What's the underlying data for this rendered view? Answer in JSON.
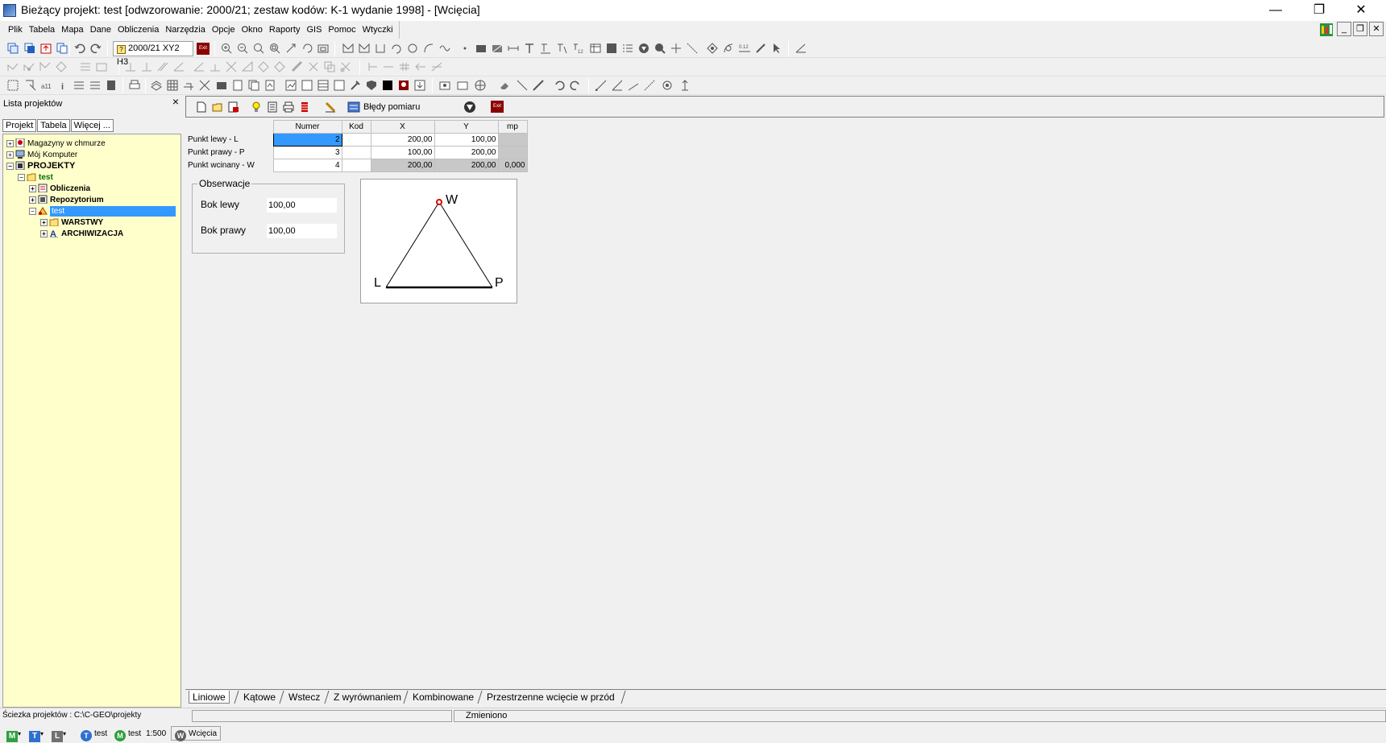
{
  "window": {
    "title": "Bieżący projekt: test [odwzorowanie: 2000/21; zestaw kodów: K-1 wydanie 1998] - [Wcięcia]",
    "minimize": "—",
    "maximize": "❐",
    "close": "✕"
  },
  "menu": [
    "Plik",
    "Tabela",
    "Mapa",
    "Dane",
    "Obliczenia",
    "Narzędzia",
    "Opcje",
    "Okno",
    "Raporty",
    "GIS",
    "Pomoc",
    "Wtyczki"
  ],
  "mdi_buttons": {
    "min": "_",
    "restore": "❐",
    "close": "✕"
  },
  "toolbar": {
    "projection_combo": "2000/21 XY2 H3",
    "exit_label": "Exit"
  },
  "left_panel": {
    "title": "Lista projektów",
    "close": "×",
    "tabs": [
      "Projekt",
      "Tabela",
      "Więcej ..."
    ],
    "tree": {
      "magazyny": "Magazyny w chmurze",
      "komputer": "Mój Komputer",
      "projekty": "PROJEKTY",
      "test_folder": "test",
      "obliczenia": "Obliczenia",
      "repozytorium": "Repozytorium",
      "test_item": "test",
      "warstwy": "WARSTWY",
      "archiwizacja": "ARCHIWIZACJA"
    }
  },
  "main_toolbar": {
    "bledy_label": "Błędy pomiaru",
    "exit_label": "Exit"
  },
  "grid": {
    "headers": [
      "Numer",
      "Kod",
      "X",
      "Y",
      "mp"
    ],
    "rows": [
      {
        "label": "Punkt lewy - L",
        "numer": "2",
        "kod": "",
        "x": "200,00",
        "y": "100,00",
        "mp": ""
      },
      {
        "label": "Punkt prawy - P",
        "numer": "3",
        "kod": "",
        "x": "100,00",
        "y": "200,00",
        "mp": ""
      },
      {
        "label": "Punkt wcinany - W",
        "numer": "4",
        "kod": "",
        "x": "200,00",
        "y": "200,00",
        "mp": "0,000"
      }
    ]
  },
  "observations": {
    "legend": "Obserwacje",
    "bok_lewy_label": "Bok lewy",
    "bok_lewy_value": "100,00",
    "bok_prawy_label": "Bok prawy",
    "bok_prawy_value": "100,00"
  },
  "diagram": {
    "left": "L",
    "right": "P",
    "top": "W"
  },
  "bottom_tabs": [
    "Liniowe",
    "Kątowe",
    "Wstecz",
    "Z wyrównaniem",
    "Kombinowane",
    "Przestrzenne wcięcie w przód"
  ],
  "status": {
    "path": "Ściezka projektów : C:\\C-GEO\\projekty",
    "changed": "Zmieniono"
  },
  "taskbar": {
    "m": "M",
    "t": "T",
    "l": "L",
    "proj1": "test",
    "proj2": "test",
    "scale": "1:500",
    "module": "Wcięcia"
  }
}
